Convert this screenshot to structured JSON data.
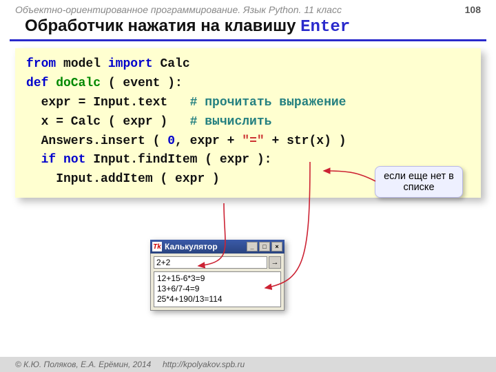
{
  "header": {
    "course": "Объектно-ориентированное программирование. Язык Python. 11 класс",
    "page": "108"
  },
  "title": {
    "text": "Обработчик нажатия на клавишу ",
    "keyword": "Enter"
  },
  "code": {
    "l1_from": "from",
    "l1_model": " model ",
    "l1_import": "import",
    "l1_calc": " Calc",
    "l2_def": "def",
    "l2_name": " doCalc",
    "l2_args": " ( event ):",
    "l3_expr": "  expr = Input.text   ",
    "l3_comment": "# прочитать выражение",
    "l4_calc": "  x = Calc ( expr )   ",
    "l4_comment": "# вычислить",
    "l5a": "  Answers.insert ( ",
    "l5_zero": "0",
    "l5b": ", expr + ",
    "l5_eq": "\"=\"",
    "l5c": " + str(x) )",
    "l6_if": "  if",
    "l6_not": " not",
    "l6_rest": " Input.findItem ( expr ):",
    "l7": "    Input.addItem ( expr )"
  },
  "callout": "если еще нет в списке",
  "window": {
    "title": "Калькулятор",
    "icon": "Tk",
    "min": "_",
    "max": "□",
    "close": "×",
    "input": "2+2",
    "go": "→",
    "rows": [
      "12+15-6*3=9",
      "13+6/7-4=9",
      "25*4+190/13=114"
    ]
  },
  "footer": {
    "authors": "© К.Ю. Поляков, Е.А. Ерёмин, 2014",
    "url": "http://kpolyakov.spb.ru"
  }
}
